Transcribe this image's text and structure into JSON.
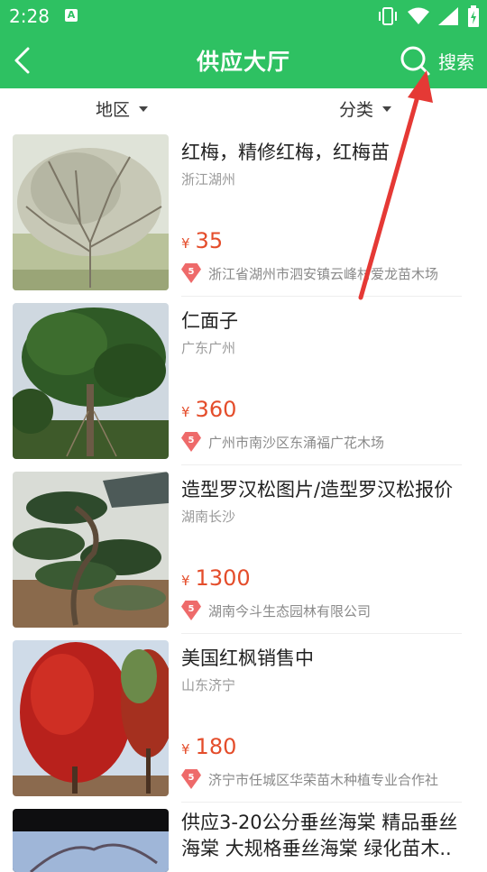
{
  "status_bar": {
    "time": "2:28",
    "notification_icon": "A"
  },
  "header": {
    "title": "供应大厅",
    "search_label": "搜索",
    "background_color": "#2ec162"
  },
  "filters": {
    "region_label": "地区",
    "category_label": "分类"
  },
  "listings": [
    {
      "title": "红梅，精修红梅，红梅苗",
      "region": "浙江湖州",
      "price_symbol": "¥",
      "price": "35",
      "supplier": "浙江省湖州市泗安镇云峰村爱龙苗木场",
      "badge": "5"
    },
    {
      "title": "仁面子",
      "region": "广东广州",
      "price_symbol": "¥",
      "price": "360",
      "supplier": "广州市南沙区东涌福广花木场",
      "badge": "5"
    },
    {
      "title": "造型罗汉松图片/造型罗汉松报价",
      "region": "湖南长沙",
      "price_symbol": "¥",
      "price": "1300",
      "supplier": "湖南今斗生态园林有限公司",
      "badge": "5"
    },
    {
      "title": "美国红枫销售中",
      "region": "山东济宁",
      "price_symbol": "¥",
      "price": "180",
      "supplier": "济宁市任城区华荣苗木种植专业合作社",
      "badge": "5"
    },
    {
      "title": "供应3-20公分垂丝海棠 精品垂丝海棠 大规格垂丝海棠 绿化苗木.."
    }
  ],
  "colors": {
    "accent": "#2ec162",
    "price": "#e44d2b",
    "badge": "#ee6a6a",
    "annotation": "#e53935"
  }
}
